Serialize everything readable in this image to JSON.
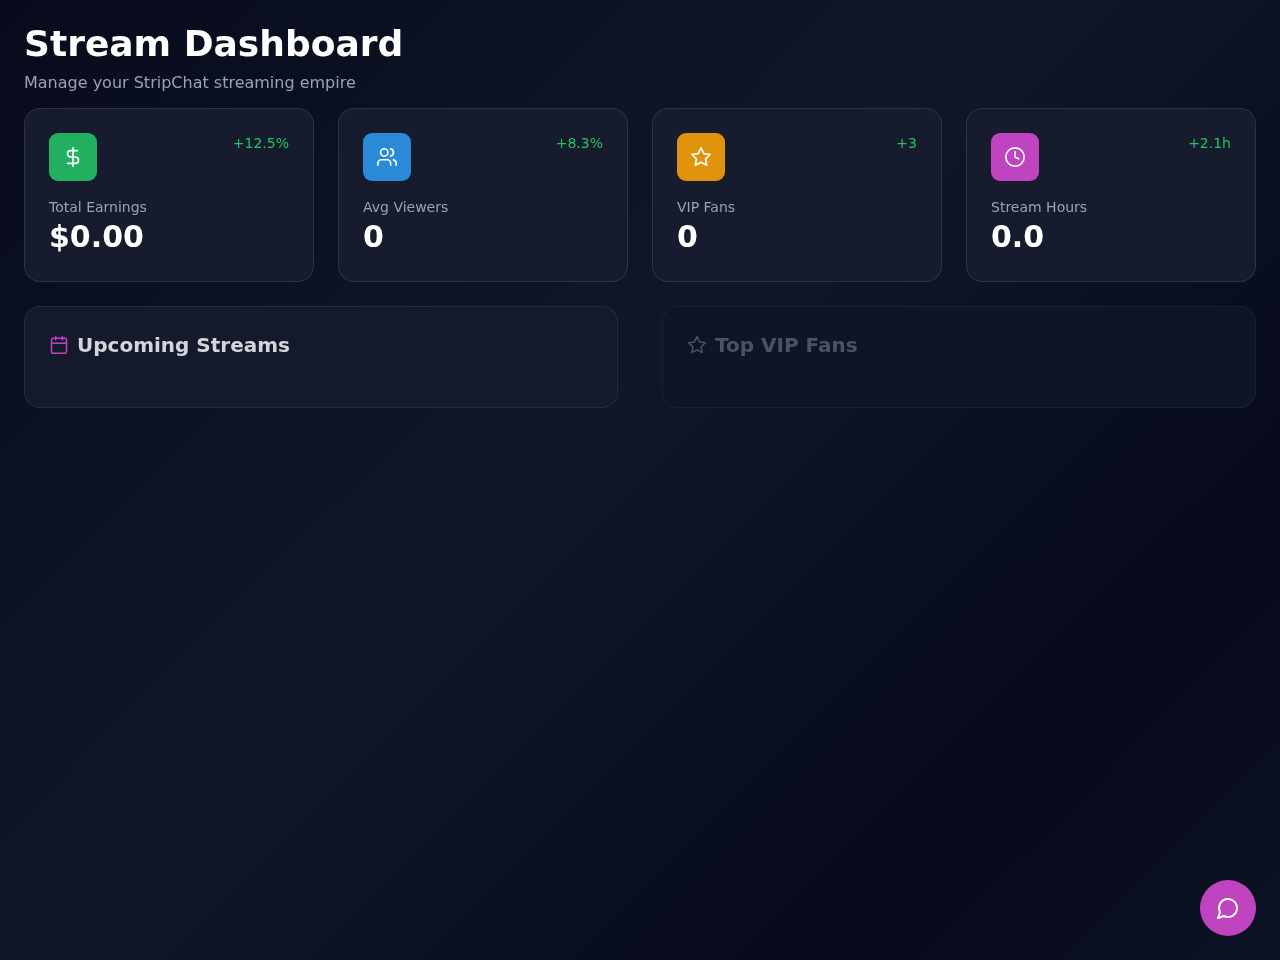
{
  "header": {
    "title": "Stream Dashboard",
    "subtitle": "Manage your StripChat streaming empire"
  },
  "stats": [
    {
      "kind": "dollar",
      "color": "#22b060",
      "label": "Total Earnings",
      "value": "$0.00",
      "change": "+12.5%"
    },
    {
      "kind": "users",
      "color": "#2a8ad8",
      "label": "Avg Viewers",
      "value": "0",
      "change": "+8.3%"
    },
    {
      "kind": "star",
      "color": "#e0940c",
      "label": "VIP Fans",
      "value": "0",
      "change": "+3"
    },
    {
      "kind": "clock",
      "color": "#c044c0",
      "label": "Stream Hours",
      "value": "0.0",
      "change": "+2.1h"
    }
  ],
  "panels": [
    {
      "kind": "calendar",
      "title": "Upcoming Streams",
      "dimmed": false
    },
    {
      "kind": "star",
      "title": "Top VIP Fans",
      "dimmed": true
    }
  ],
  "chat_button": {
    "kind": "chat"
  }
}
